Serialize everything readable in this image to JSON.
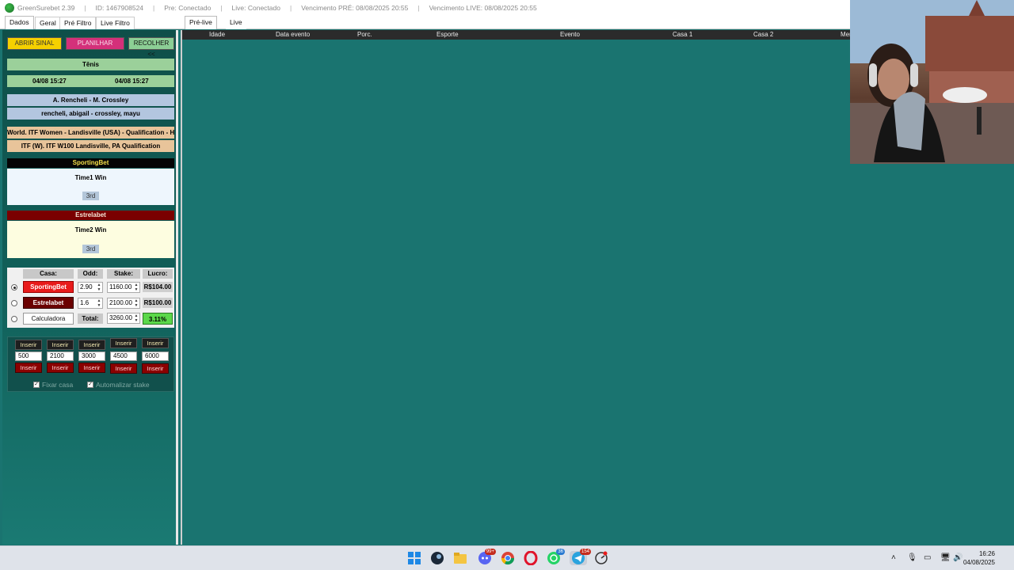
{
  "titlebar": {
    "app": "GreenSurebet 2.39",
    "id": "ID: 1467908524",
    "pre": "Pre: Conectado",
    "live": "Live: Conectado",
    "venc_pre": "Vencimento PRÉ: 08/08/2025 20:55",
    "venc_live": "Vencimento LIVE: 08/08/2025 20:55"
  },
  "left_tabs": [
    "Dados",
    "Geral",
    "Pré Filtro",
    "Live Filtro"
  ],
  "main_tabs": [
    "Pré-live",
    "Live"
  ],
  "buttons": {
    "abrir": "ABRIR SINAL",
    "planilhar": "PLANILHAR",
    "recolher": "RECOLHER <<"
  },
  "sport": "Tênis",
  "dates": [
    "04/08 15:27",
    "04/08 15:27"
  ],
  "match": "A. Rencheli - M. Crossley",
  "match_keys": "rencheli, abigail - crossley, mayu",
  "league1": "World. ITF Women - Landisville (USA) - Qualification - Har",
  "league2": "ITF (W). ITF W100 Landisville, PA Qualification",
  "book1": {
    "name": "SportingBet",
    "market": "Time1 Win",
    "tag": "3rd"
  },
  "book2": {
    "name": "Estrelabet",
    "market": "Time2 Win",
    "tag": "3rd"
  },
  "calc": {
    "headers": [
      "Casa:",
      "Odd:",
      "Stake:",
      "Lucro:"
    ],
    "rows": [
      {
        "casa": "SportingBet",
        "odd": "2.90",
        "stake": "1160.00",
        "lucro": "R$104.00"
      },
      {
        "casa": "Estrelabet",
        "odd": "1.6",
        "stake": "2100.00",
        "lucro": "R$100.00"
      }
    ],
    "calc_label": "Calculadora",
    "total_label": "Total:",
    "total": "3260.00",
    "pct": "3.11%"
  },
  "quick": {
    "btn": "Inserir",
    "values": [
      "500",
      "2100",
      "3000",
      "4500",
      "6000"
    ],
    "fixar": "Fixar casa",
    "auto": "Automalizar stake"
  },
  "columns": [
    "Idade",
    "Data evento",
    "Porc.",
    "Esporte",
    "Evento",
    "Casa 1",
    "Casa 2",
    "Mer"
  ],
  "taskbar": {
    "time": "16:26",
    "date": "04/08/2025",
    "badges": [
      "99+",
      "36",
      "154"
    ]
  },
  "colors": {
    "teal": "#1a7470",
    "yellow": "#f5d000",
    "magenta": "#d4307a",
    "green": "#5bd84a"
  }
}
